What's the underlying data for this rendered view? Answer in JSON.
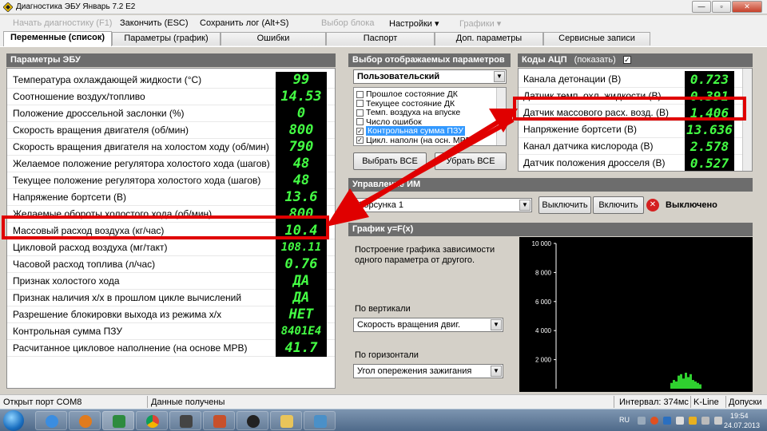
{
  "window": {
    "title": "Диагностика ЭБУ Январь 7.2 E2"
  },
  "menu": {
    "start_diag": "Начать диагностику (F1)",
    "finish": "Закончить (ESC)",
    "save_log": "Сохранить лог (Alt+S)",
    "block_select": "Выбор блока",
    "settings": "Настройки ▾",
    "graphs": "Графики ▾"
  },
  "tabs": [
    {
      "label": "Переменные (список)"
    },
    {
      "label": "Параметры (график)"
    },
    {
      "label": "Ошибки"
    },
    {
      "label": "Паспорт"
    },
    {
      "label": "Доп. параметры"
    },
    {
      "label": "Сервисные записи"
    }
  ],
  "ecu": {
    "title": "Параметры ЭБУ",
    "rows": [
      {
        "label": "Температура охлаждающей жидкости (°C)",
        "value": "99"
      },
      {
        "label": "Соотношение воздух/топливо",
        "value": "14.53"
      },
      {
        "label": "Положение дроссельной заслонки (%)",
        "value": "0"
      },
      {
        "label": "Скорость вращения двигателя (об/мин)",
        "value": "800"
      },
      {
        "label": "Скорость вращения двигателя на холостом ходу (об/мин)",
        "value": "790"
      },
      {
        "label": "Желаемое положение регулятора холостого хода (шагов)",
        "value": "48"
      },
      {
        "label": "Текущее положение регулятора холостого хода (шагов)",
        "value": "48"
      },
      {
        "label": "Напряжение бортсети (В)",
        "value": "13.6"
      },
      {
        "label": "Желаемые обороты холостого хода (об/мин)",
        "value": "800"
      },
      {
        "label": "Массовый расход воздуха (кг/час)",
        "value": "10.4"
      },
      {
        "label": "Цикловой расход воздуха (мг/такт)",
        "value": "108.11"
      },
      {
        "label": "Часовой расход топлива (л/час)",
        "value": "0.76"
      },
      {
        "label": "Признак холостого хода",
        "value": "ДА"
      },
      {
        "label": "Признак наличия х/х в прошлом цикле вычислений",
        "value": "ДА"
      },
      {
        "label": "Разрешение блокировки выхода из режима х/х",
        "value": "НЕТ"
      },
      {
        "label": "Контрольная сумма ПЗУ",
        "value": "8401E4"
      },
      {
        "label": "Расчитанное цикловое наполнение (на основе МРВ)",
        "value": "41.7"
      }
    ]
  },
  "selection": {
    "title": "Выбор отображаемых параметров",
    "preset": "Пользовательский",
    "items": [
      {
        "label": "Прошлое состояние ДК",
        "checked": false
      },
      {
        "label": "Текущее состояние ДК",
        "checked": false
      },
      {
        "label": "Темп. воздуха на впуске",
        "checked": false
      },
      {
        "label": "Число ошибок",
        "checked": false
      },
      {
        "label": "Контрольная сумма ПЗУ",
        "checked": true
      },
      {
        "label": "Цикл. наполн (на осн. МРВ)",
        "checked": true
      }
    ],
    "select_all": "Выбрать ВСЕ",
    "deselect_all": "Убрать ВСЕ"
  },
  "adc": {
    "title": "Коды АЦП",
    "show_label": "(показать)",
    "rows": [
      {
        "label": "Канала детонации (В)",
        "value": "0.723"
      },
      {
        "label": "Датчик темп. охл. жидкости (В)",
        "value": "0.391"
      },
      {
        "label": "Датчик массового расх. возд. (В)",
        "value": "1.406"
      },
      {
        "label": "Напряжение бортсети (В)",
        "value": "13.636"
      },
      {
        "label": "Канал датчика кислорода (В)",
        "value": "2.578"
      },
      {
        "label": "Датчик положения дросселя (В)",
        "value": "0.527"
      }
    ]
  },
  "im": {
    "title": "Управление ИМ",
    "device": "Форсунка 1",
    "off_button": "Выключить",
    "on_button": "Включить",
    "status": "Выключено"
  },
  "graph": {
    "title": "График y=F(x)",
    "description": "Построение графика зависимости одного параметра от другого.",
    "vertical_label": "По вертикали",
    "vertical_value": "Скорость вращения двиг.",
    "horizontal_label": "По горизонтали",
    "horizontal_value": "Угол опережения зажигания"
  },
  "chart_data": {
    "type": "scatter",
    "title": "",
    "xlabel": "",
    "ylabel": "",
    "ylim": [
      0,
      10000
    ],
    "y_ticks": [
      "10 000",
      "8 000",
      "6 000",
      "4 000",
      "2 000"
    ],
    "grid": false,
    "x": [
      0.1,
      0.2,
      0.3,
      0.4,
      0.5,
      0.6,
      0.7,
      0.8,
      0.9,
      1.0,
      1.1,
      1.2,
      1.3
    ],
    "values": [
      400,
      600,
      500,
      900,
      1000,
      700,
      1100,
      800,
      1000,
      600,
      500,
      400,
      300
    ]
  },
  "statusbar": {
    "port": "Открыт порт COM8",
    "data": "Данные получены",
    "interval": "Интервал: 374мс",
    "protocol": "K-Line",
    "tolerances": "Допуски"
  },
  "tray": {
    "lang": "RU",
    "time": "19:54",
    "date": "24.07.2013"
  },
  "colors": {
    "lcd_bg": "#000000",
    "lcd_text": "#44ff44",
    "highlight": "#e00000"
  }
}
